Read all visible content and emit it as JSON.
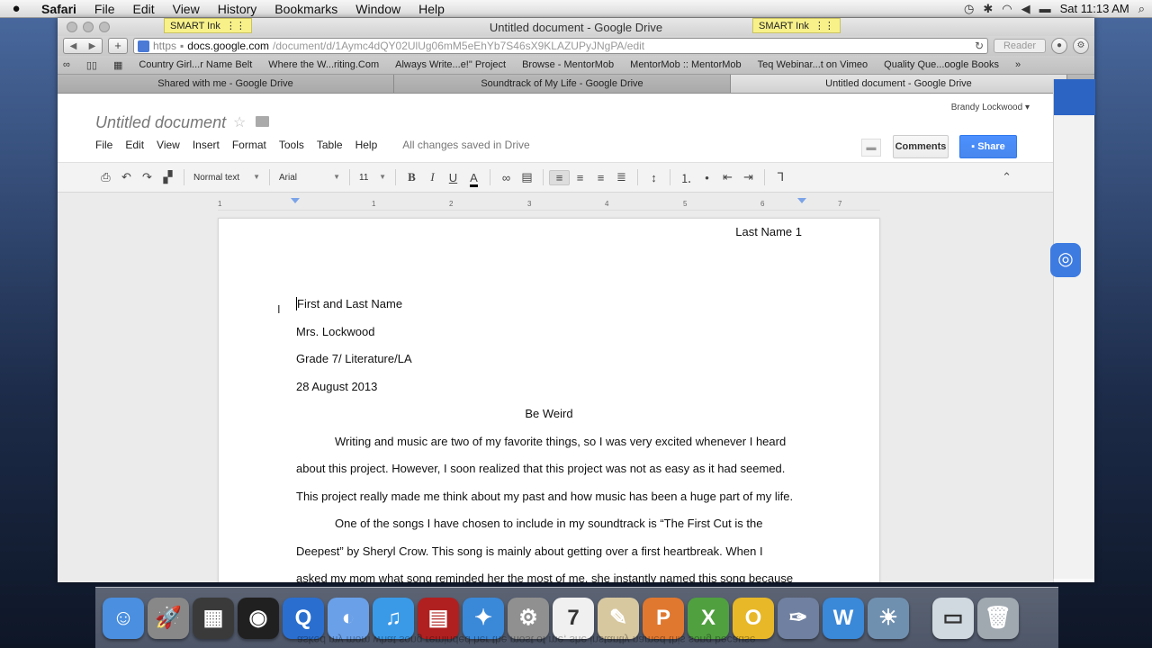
{
  "menubar": {
    "app": "Safari",
    "items": [
      "File",
      "Edit",
      "View",
      "History",
      "Bookmarks",
      "Window",
      "Help"
    ],
    "clock": "Sat 11:13 AM"
  },
  "window": {
    "title": "Untitled document - Google Drive",
    "smart_ink_label": "SMART Ink"
  },
  "toolbar": {
    "url_scheme": "https",
    "url_host": "docs.google.com",
    "url_path": "/document/d/1Aymc4dQY02UlUg06mM5eEhYb7S46sX9KLAZUPyJNgPA/edit",
    "reader_label": "Reader"
  },
  "bookmarks": [
    "Country Girl...r Name Belt",
    "Where the W...riting.Com",
    "Always Write...e!\" Project",
    "Browse - MentorMob",
    "MentorMob :: MentorMob",
    "Teq Webinar...t on Vimeo",
    "Quality Que...oogle Books"
  ],
  "tabs": [
    {
      "label": "Shared with me - Google Drive",
      "active": false
    },
    {
      "label": "Soundtrack of My Life - Google Drive",
      "active": false
    },
    {
      "label": "Untitled document - Google Drive",
      "active": true
    }
  ],
  "docs": {
    "title": "Untitled document",
    "user": "Brandy Lockwood",
    "comments_label": "Comments",
    "share_label": "Share",
    "menu": [
      "File",
      "Edit",
      "View",
      "Insert",
      "Format",
      "Tools",
      "Table",
      "Help"
    ],
    "save_status": "All changes saved in Drive"
  },
  "format_toolbar": {
    "style": "Normal text",
    "font": "Arial",
    "size": "11"
  },
  "ruler": [
    "1",
    "1",
    "2",
    "3",
    "4",
    "5",
    "6",
    "7"
  ],
  "document": {
    "header": "Last Name 1",
    "lines": [
      "First and Last Name",
      "Mrs. Lockwood",
      "Grade 7/ Literature/LA",
      "28 August 2013",
      "Be Weird",
      "Writing and music are two of my favorite things, so I was very excited whenever I heard",
      "about this project.  However, I soon realized that this project was not as easy as it had seemed.",
      "This project really made me think about my past and how music has been a huge part of my life.",
      "One of the songs I have chosen to include in my soundtrack is “The First Cut is the",
      "Deepest” by Sheryl Crow.  This song is mainly about getting over a first heartbreak.  When I",
      "asked my mom what song reminded her the most of me, she instantly named this song because"
    ]
  },
  "dock": [
    {
      "name": "finder-icon",
      "color": "#4a8fe0",
      "glyph": "☺"
    },
    {
      "name": "launchpad-icon",
      "color": "#888888",
      "glyph": "🚀"
    },
    {
      "name": "dashboard-icon",
      "color": "#3a3a3a",
      "glyph": "▦"
    },
    {
      "name": "photo-booth-icon",
      "color": "#202020",
      "glyph": "◉"
    },
    {
      "name": "quicktime-icon",
      "color": "#2a6fd0",
      "glyph": "Q"
    },
    {
      "name": "facetime-icon",
      "color": "#6aa0e8",
      "glyph": "◐"
    },
    {
      "name": "itunes-icon",
      "color": "#3a9ae8",
      "glyph": "♫"
    },
    {
      "name": "photo-icon",
      "color": "#b02020",
      "glyph": "▤"
    },
    {
      "name": "safari-icon",
      "color": "#3a88d8",
      "glyph": "✦"
    },
    {
      "name": "system-preferences-icon",
      "color": "#909090",
      "glyph": "⚙"
    },
    {
      "name": "calendar-icon",
      "color": "#f0f0f0",
      "glyph": "7"
    },
    {
      "name": "preview-icon",
      "color": "#d8c8a0",
      "glyph": "✎"
    },
    {
      "name": "powerpoint-icon",
      "color": "#e07830",
      "glyph": "P"
    },
    {
      "name": "excel-icon",
      "color": "#50a040",
      "glyph": "X"
    },
    {
      "name": "outlook-icon",
      "color": "#e8b828",
      "glyph": "O"
    },
    {
      "name": "script-editor-icon",
      "color": "#7080a0",
      "glyph": "✑"
    },
    {
      "name": "word-icon",
      "color": "#3a88d8",
      "glyph": "W"
    },
    {
      "name": "iphoto-icon",
      "color": "#7090b0",
      "glyph": "☀"
    },
    {
      "name": "downloads-icon",
      "color": "#d0d8e0",
      "glyph": "▭"
    },
    {
      "name": "trash-icon",
      "color": "#a0a8b0",
      "glyph": "🗑"
    }
  ]
}
